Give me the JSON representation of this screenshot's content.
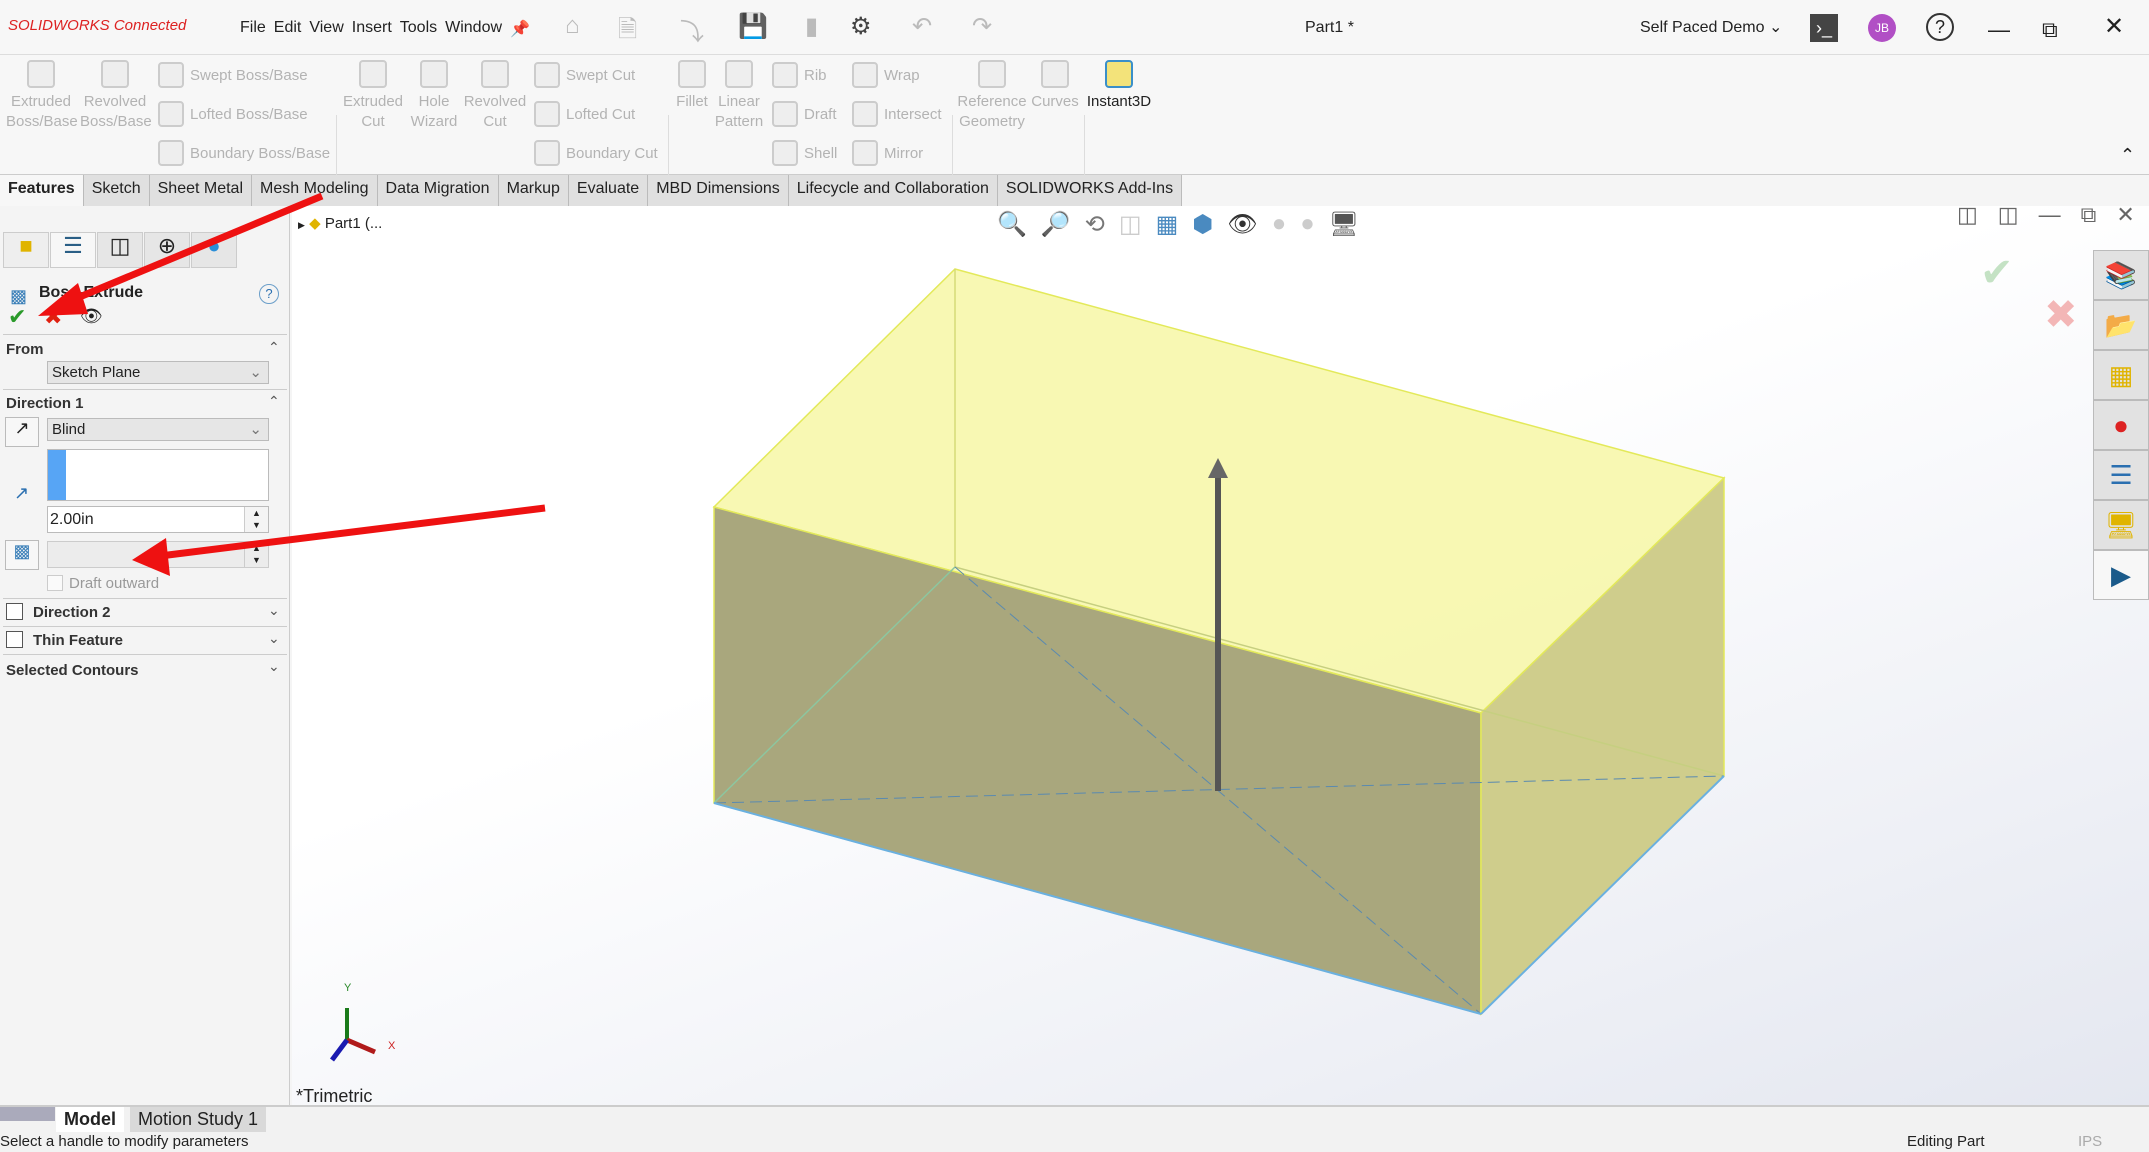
{
  "app": {
    "logo_text": "SOLIDWORKS Connected",
    "document_title": "Part1 *",
    "workspace": "Self Paced Demo",
    "user_initials": "JB",
    "user_color": "#b14fc5"
  },
  "menu": [
    "File",
    "Edit",
    "View",
    "Insert",
    "Tools",
    "Window"
  ],
  "ribbon": {
    "large": [
      {
        "label": "Extruded\nBoss/Base"
      },
      {
        "label": "Revolved\nBoss/Base"
      },
      {
        "label": "Extruded\nCut"
      },
      {
        "label": "Hole\nWizard"
      },
      {
        "label": "Revolved\nCut"
      },
      {
        "label": "Fillet"
      },
      {
        "label": "Linear\nPattern"
      },
      {
        "label": "Reference\nGeometry"
      },
      {
        "label": "Curves"
      },
      {
        "label": "Instant3D"
      }
    ],
    "small": [
      "Swept Boss/Base",
      "Lofted Boss/Base",
      "Boundary Boss/Base",
      "Swept Cut",
      "Lofted Cut",
      "Boundary Cut",
      "Rib",
      "Draft",
      "Shell",
      "Wrap",
      "Intersect",
      "Mirror"
    ]
  },
  "tabs": [
    "Features",
    "Sketch",
    "Sheet Metal",
    "Mesh Modeling",
    "Data Migration",
    "Markup",
    "Evaluate",
    "MBD Dimensions",
    "Lifecycle and Collaboration",
    "SOLIDWORKS Add-Ins"
  ],
  "active_tab": "Features",
  "property_manager": {
    "title": "Boss-Extrude",
    "from_label": "From",
    "from_value": "Sketch Plane",
    "direction1_label": "Direction 1",
    "end_condition": "Blind",
    "depth": "2.00in",
    "draft_outward": "Draft outward",
    "direction2_label": "Direction 2",
    "thin_feature_label": "Thin Feature",
    "selected_contours_label": "Selected Contours"
  },
  "tree": {
    "root": "Part1 (..."
  },
  "viewport": {
    "view_name": "*Trimetric",
    "axis_x": "X",
    "axis_y": "Y",
    "model_color": "#f5f5a0"
  },
  "bottom_tabs": [
    "Model",
    "Motion Study 1"
  ],
  "status": {
    "message": "Select a handle to modify parameters",
    "mode": "Editing Part",
    "units": "IPS"
  },
  "annotation_color": "#ee1111"
}
